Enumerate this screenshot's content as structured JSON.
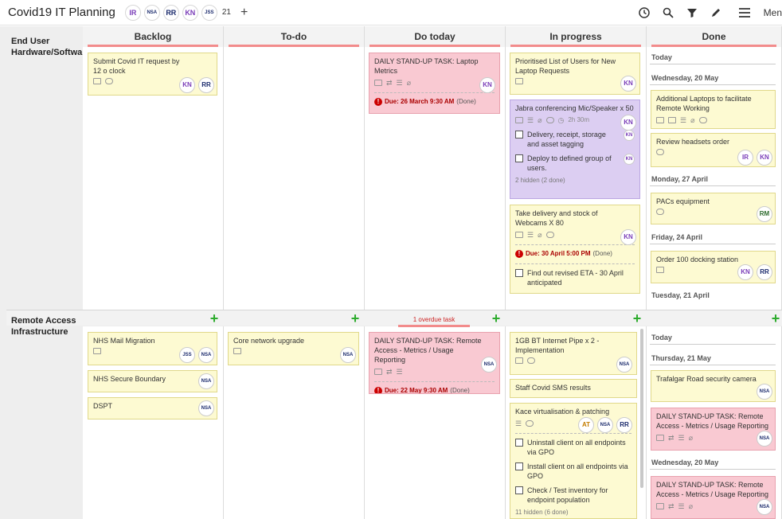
{
  "topbar": {
    "title": "Covid19 IT Planning",
    "avatars": [
      "IR",
      "NSA",
      "RR",
      "KN",
      "JSS"
    ],
    "member_count": "21",
    "add_label": "+",
    "menu_label": "Men"
  },
  "columns": [
    "Backlog",
    "To-do",
    "Do today",
    "In progress",
    "Done"
  ],
  "lanes": [
    "End User Hardware/Software",
    "Remote Access Infrastructure"
  ],
  "lane2_overdue": "1 overdue task",
  "cards": {
    "backlog1": {
      "title": "Submit Covid IT request by 12 o clock",
      "people": [
        "KN",
        "RR"
      ]
    },
    "today1": {
      "title": "DAILY STAND-UP TASK: Laptop Metrics",
      "people": [
        "KN"
      ],
      "due": "Due: 26 March 9:30 AM",
      "due_state": "(Done)"
    },
    "prog1": {
      "title": "Prioritised List of Users for New Laptop Requests",
      "people": [
        "KN"
      ]
    },
    "prog2": {
      "title": "Jabra conferencing Mic/Speaker x 50",
      "people": [
        "KN"
      ],
      "duration": "2h 30m",
      "checks": [
        "Delivery, receipt, storage and asset tagging",
        "Deploy to defined group of users."
      ],
      "check_people": [
        "KN",
        "KN"
      ],
      "hidden": "2 hidden (2 done)"
    },
    "prog3": {
      "title": "Take delivery and stock of Webcams X 80",
      "people": [
        "KN"
      ],
      "due": "Due: 30 April 5:00 PM",
      "due_state": "(Done)",
      "checks": [
        "Find out revised ETA - 30 April anticipated"
      ]
    },
    "lane2_backlog1": {
      "title": "NHS Mail Migration",
      "people": [
        "JSS",
        "NSA"
      ]
    },
    "lane2_backlog2": {
      "title": "NHS Secure Boundary",
      "people": [
        "NSA"
      ]
    },
    "lane2_backlog3": {
      "title": "DSPT",
      "people": [
        "NSA"
      ]
    },
    "lane2_todo1": {
      "title": "Core network upgrade",
      "people": [
        "NSA"
      ]
    },
    "lane2_today1": {
      "title": "DAILY STAND-UP TASK: Remote Access - Metrics / Usage Reporting",
      "people": [
        "NSA"
      ],
      "due": "Due: 22 May 9:30 AM",
      "due_state": "(Done)"
    },
    "lane2_prog1": {
      "title": "1GB BT Internet Pipe x 2 - Implementation",
      "people": [
        "NSA"
      ]
    },
    "lane2_prog2": {
      "title": "Staff Covid SMS results"
    },
    "lane2_prog3": {
      "title": "Kace virtualisation & patching",
      "people": [
        "AT",
        "NSA",
        "RR"
      ],
      "checks": [
        "Uninstall client on all endpoints via GPO",
        "Install client on all endpoints via GPO",
        "Check / Test inventory for endpoint population"
      ],
      "hidden": "11 hidden (6 done)"
    }
  },
  "done": {
    "lane1": [
      {
        "date": "Today"
      },
      {
        "date": "Wednesday, 20 May"
      },
      {
        "title": "Additional Laptops to facilitate Remote Working"
      },
      {
        "title": "Review headsets order",
        "people": [
          "IR",
          "KN"
        ]
      },
      {
        "date": "Monday, 27 April"
      },
      {
        "title": "PACs equipment",
        "people": [
          "RM"
        ]
      },
      {
        "date": "Friday, 24 April"
      },
      {
        "title": "Order 100 docking station",
        "people": [
          "KN",
          "RR"
        ]
      },
      {
        "date": "Tuesday, 21 April"
      }
    ],
    "lane2": [
      {
        "date": "Today"
      },
      {
        "date": "Thursday, 21 May"
      },
      {
        "title": "Trafalgar Road security camera",
        "people": [
          "NSA"
        ]
      },
      {
        "title": "DAILY STAND-UP TASK: Remote Access - Metrics / Usage Reporting",
        "people": [
          "NSA"
        ]
      },
      {
        "date": "Wednesday, 20 May"
      },
      {
        "title": "DAILY STAND-UP TASK: Remote Access - Metrics / Usage Reporting",
        "people": [
          "NSA"
        ]
      }
    ]
  }
}
